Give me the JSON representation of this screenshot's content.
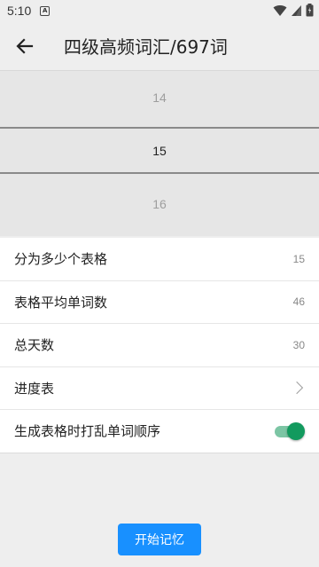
{
  "status_bar": {
    "time": "5:10",
    "notification_glyph": "A"
  },
  "app_bar": {
    "title": "四级高频词汇/697词"
  },
  "picker": {
    "above": "14",
    "selected": "15",
    "below": "16"
  },
  "settings": {
    "items": [
      {
        "label": "分为多少个表格",
        "value": "15"
      },
      {
        "label": "表格平均单词数",
        "value": "46"
      },
      {
        "label": "总天数",
        "value": "30"
      },
      {
        "label": "进度表"
      },
      {
        "label": "生成表格时打乱单词顺序",
        "toggle_on": true
      }
    ]
  },
  "start_button": {
    "label": "开始记忆"
  },
  "colors": {
    "accent": "#1890ff",
    "toggle_on": "#129a5e"
  }
}
